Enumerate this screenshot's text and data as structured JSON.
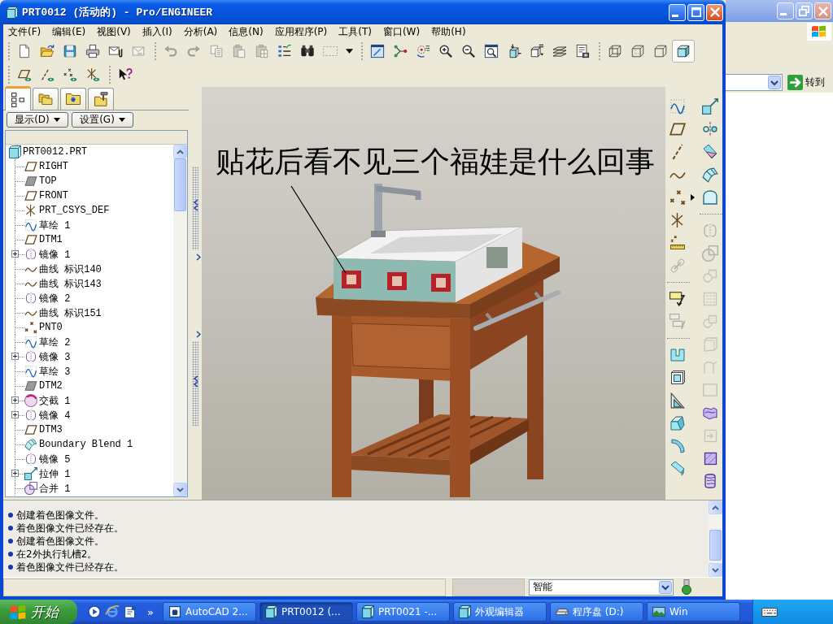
{
  "window": {
    "title": "PRT0012 (活动的) - Pro/ENGINEER"
  },
  "menu": [
    "文件(F)",
    "编辑(E)",
    "视图(V)",
    "插入(I)",
    "分析(A)",
    "信息(N)",
    "应用程序(P)",
    "工具(T)",
    "窗口(W)",
    "帮助(H)"
  ],
  "toolbars": [
    {
      "groups": [
        {
          "buttons": [
            {
              "kind": "new",
              "disabled": false
            },
            {
              "kind": "open",
              "disabled": false
            },
            {
              "kind": "save",
              "disabled": false
            },
            {
              "kind": "print",
              "disabled": false
            },
            {
              "kind": "mail_clip",
              "disabled": false
            },
            {
              "kind": "mail",
              "disabled": true
            }
          ]
        },
        {
          "buttons": [
            {
              "kind": "undo",
              "disabled": true
            },
            {
              "kind": "redo",
              "disabled": true
            },
            {
              "kind": "copy",
              "disabled": true
            },
            {
              "kind": "paste",
              "disabled": true
            },
            {
              "kind": "paste_special",
              "disabled": true
            },
            {
              "kind": "regenerate",
              "disabled": false
            },
            {
              "kind": "find",
              "disabled": false
            },
            {
              "kind": "select_box",
              "disabled": true
            },
            {
              "kind": "caret",
              "disabled": false
            }
          ]
        },
        {
          "buttons": [
            {
              "kind": "repaint",
              "disabled": false
            },
            {
              "kind": "spin_center",
              "disabled": false
            },
            {
              "kind": "orient",
              "disabled": false
            },
            {
              "kind": "zoom_in",
              "disabled": false
            },
            {
              "kind": "zoom_out",
              "disabled": false
            },
            {
              "kind": "refit",
              "disabled": false
            },
            {
              "kind": "reorient",
              "disabled": false
            },
            {
              "kind": "saved_views",
              "disabled": false
            },
            {
              "kind": "layers",
              "disabled": false
            },
            {
              "kind": "model_setup",
              "disabled": false
            }
          ]
        },
        {
          "buttons": [
            {
              "kind": "wireframe",
              "disabled": false,
              "selected": false
            },
            {
              "kind": "hidden_line",
              "disabled": false,
              "selected": false
            },
            {
              "kind": "no_hidden",
              "disabled": false,
              "selected": false
            },
            {
              "kind": "shading",
              "disabled": false,
              "selected": true
            }
          ]
        }
      ]
    },
    {
      "groups": [
        {
          "buttons": [
            {
              "kind": "plane_display",
              "disabled": false
            },
            {
              "kind": "axis_display",
              "disabled": false
            },
            {
              "kind": "point_display",
              "disabled": false
            },
            {
              "kind": "csys_display",
              "disabled": false
            }
          ]
        },
        {
          "buttons": [
            {
              "kind": "help",
              "disabled": false
            }
          ]
        }
      ]
    }
  ],
  "panel": {
    "tabs": [
      {
        "kind": "model_tree",
        "selected": true
      },
      {
        "kind": "folders",
        "selected": false
      },
      {
        "kind": "favorites",
        "selected": false
      },
      {
        "kind": "tools",
        "selected": false
      }
    ],
    "buttons": [
      "显示(D)",
      "设置(G)"
    ]
  },
  "model_tree": {
    "root": "PRT0012.PRT",
    "items": [
      {
        "kind": "plane",
        "label": "RIGHT",
        "expandable": false
      },
      {
        "kind": "plane_shaded",
        "label": "TOP",
        "expandable": false
      },
      {
        "kind": "plane",
        "label": "FRONT",
        "expandable": false
      },
      {
        "kind": "csys",
        "label": "PRT_CSYS_DEF",
        "expandable": false
      },
      {
        "kind": "sketch",
        "label": "草绘 1",
        "expandable": false
      },
      {
        "kind": "plane",
        "label": "DTM1",
        "expandable": false
      },
      {
        "kind": "mirror",
        "label": "镜像 1",
        "expandable": true
      },
      {
        "kind": "curve",
        "label": "曲线 标识140",
        "expandable": false
      },
      {
        "kind": "curve",
        "label": "曲线 标识143",
        "expandable": false
      },
      {
        "kind": "mirror",
        "label": "镜像 2",
        "expandable": false
      },
      {
        "kind": "curve",
        "label": "曲线 标识151",
        "expandable": false
      },
      {
        "kind": "point",
        "label": "PNT0",
        "expandable": false
      },
      {
        "kind": "sketch",
        "label": "草绘 2",
        "expandable": false
      },
      {
        "kind": "mirror",
        "label": "镜像 3",
        "expandable": true
      },
      {
        "kind": "sketch",
        "label": "草绘 3",
        "expandable": false
      },
      {
        "kind": "plane_shaded",
        "label": "DTM2",
        "expandable": false
      },
      {
        "kind": "intersect_curve",
        "label": "交截 1",
        "expandable": true
      },
      {
        "kind": "mirror",
        "label": "镜像 4",
        "expandable": true
      },
      {
        "kind": "plane",
        "label": "DTM3",
        "expandable": false
      },
      {
        "kind": "blend",
        "label": "Boundary Blend 1",
        "expandable": false
      },
      {
        "kind": "mirror",
        "label": "镜像 5",
        "expandable": false
      },
      {
        "kind": "extrude",
        "label": "拉伸 1",
        "expandable": true
      },
      {
        "kind": "merge",
        "label": "合并 1",
        "expandable": false
      }
    ]
  },
  "viewport": {
    "annotation": "贴花后看不见三个福娃是什么回事"
  },
  "feature_toolbar": {
    "columns": [
      {
        "groups": [
          {
            "buttons": [
              {
                "kind": "sketch",
                "disabled": false,
                "flyout": false
              },
              {
                "kind": "plane",
                "disabled": false,
                "flyout": false
              },
              {
                "kind": "axis",
                "disabled": false,
                "flyout": false
              },
              {
                "kind": "curve",
                "disabled": false,
                "flyout": false
              },
              {
                "kind": "point",
                "disabled": false,
                "flyout": true
              },
              {
                "kind": "csys",
                "disabled": false,
                "flyout": false
              },
              {
                "kind": "analysis",
                "disabled": false,
                "flyout": false
              },
              {
                "kind": "link",
                "disabled": true,
                "flyout": false
              }
            ]
          },
          {
            "buttons": [
              {
                "kind": "note",
                "disabled": false,
                "flyout": false
              },
              {
                "kind": "note_stack",
                "disabled": true,
                "flyout": false
              }
            ]
          },
          {
            "buttons": [
              {
                "kind": "hole",
                "disabled": false,
                "flyout": false
              },
              {
                "kind": "shell",
                "disabled": false,
                "flyout": false
              },
              {
                "kind": "rib",
                "disabled": false,
                "flyout": false
              },
              {
                "kind": "draft",
                "disabled": false,
                "flyout": false
              },
              {
                "kind": "round",
                "disabled": false,
                "flyout": false
              },
              {
                "kind": "chamfer",
                "disabled": false,
                "flyout": false
              }
            ]
          }
        ]
      },
      {
        "groups": [
          {
            "buttons": [
              {
                "kind": "extrude",
                "disabled": false,
                "flyout": false
              },
              {
                "kind": "revolve",
                "disabled": false,
                "flyout": false
              },
              {
                "kind": "sweep",
                "disabled": false,
                "flyout": false
              },
              {
                "kind": "blend",
                "disabled": false,
                "flyout": false
              },
              {
                "kind": "style",
                "disabled": false,
                "flyout": false
              }
            ]
          },
          {
            "buttons": [
              {
                "kind": "mirror",
                "disabled": true,
                "flyout": false
              },
              {
                "kind": "merge",
                "disabled": true,
                "flyout": false
              },
              {
                "kind": "trim",
                "disabled": true,
                "flyout": false
              },
              {
                "kind": "pattern",
                "disabled": true,
                "flyout": false
              },
              {
                "kind": "intersect",
                "disabled": true,
                "flyout": false
              },
              {
                "kind": "offset",
                "disabled": true,
                "flyout": false
              },
              {
                "kind": "thicken",
                "disabled": true,
                "flyout": false
              },
              {
                "kind": "solidify",
                "disabled": true,
                "flyout": false
              },
              {
                "kind": "warp",
                "disabled": false,
                "flyout": false
              },
              {
                "kind": "toolkit",
                "disabled": true,
                "flyout": false
              },
              {
                "kind": "fill",
                "disabled": false,
                "flyout": false
              },
              {
                "kind": "cylinder",
                "disabled": false,
                "flyout": false
              }
            ]
          }
        ]
      }
    ]
  },
  "messages": [
    "创建着色图像文件。",
    "着色图像文件已经存在。",
    "创建着色图像文件。",
    "在2外执行轧槽2。",
    "着色图像文件已经存在。"
  ],
  "status_bar": {
    "filter": "智能"
  },
  "background_window": {
    "go_button": "转到"
  },
  "taskbar": {
    "start": "开始",
    "quick_launch": [
      {
        "kind": "player"
      },
      {
        "kind": "browser"
      },
      {
        "kind": "notes"
      }
    ],
    "more": "»",
    "buttons": [
      {
        "label": "AutoCAD 2...",
        "kind": "app",
        "selected": false
      },
      {
        "label": "PRT0012 (...",
        "kind": "cube",
        "selected": true
      },
      {
        "label": "PRT0021 -...",
        "kind": "cube",
        "selected": false
      },
      {
        "label": "外观编辑器",
        "kind": "cube",
        "selected": false
      },
      {
        "label": "程序盘 (D:)",
        "kind": "drive",
        "selected": false
      },
      {
        "label": "Win",
        "kind": "picture",
        "selected": false
      }
    ]
  }
}
